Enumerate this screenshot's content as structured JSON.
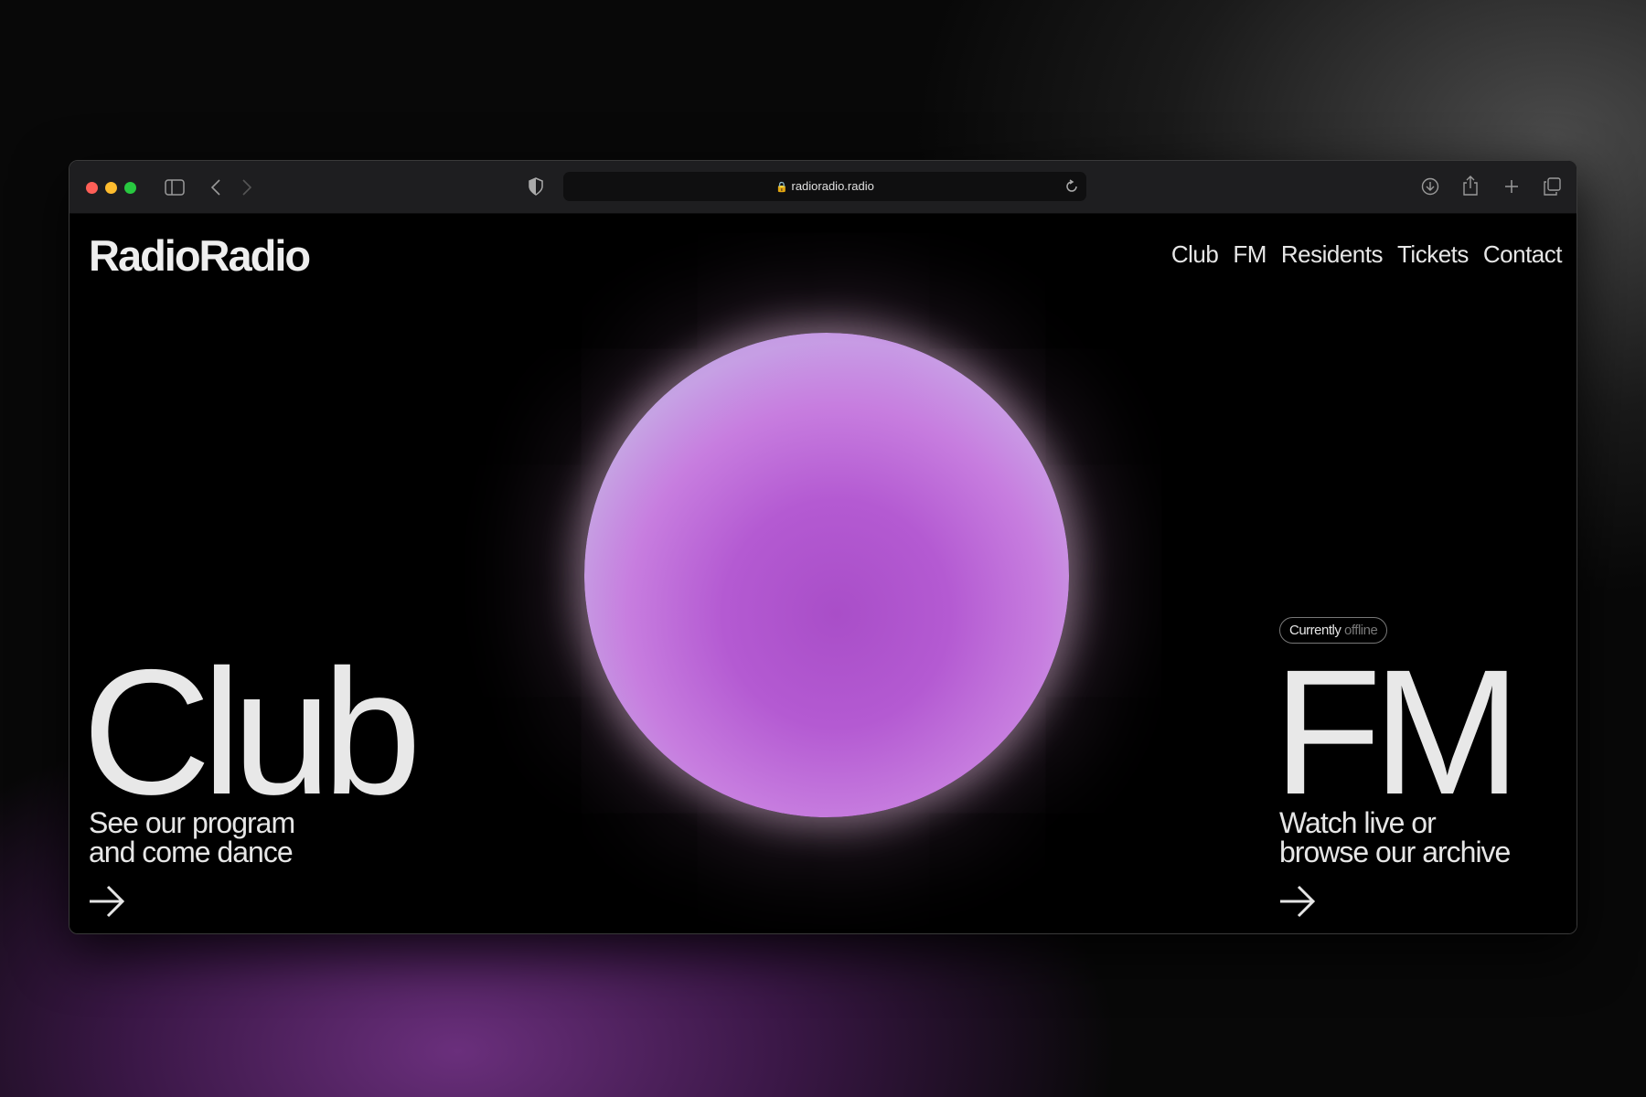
{
  "browser": {
    "url": "radioradio.radio",
    "traffic_colors": {
      "close": "#ff5f57",
      "minimize": "#febc2e",
      "zoom": "#28c840"
    }
  },
  "site": {
    "logo": "RadioRadio",
    "nav": [
      "Club",
      "FM",
      "Residents",
      "Tickets",
      "Contact"
    ]
  },
  "club": {
    "title": "Club",
    "line1": "See our program",
    "line2": "and come dance"
  },
  "fm": {
    "status_label": "Currently",
    "status_value": "offline",
    "title": "FM",
    "line1": "Watch live or",
    "line2": "browse our archive"
  }
}
